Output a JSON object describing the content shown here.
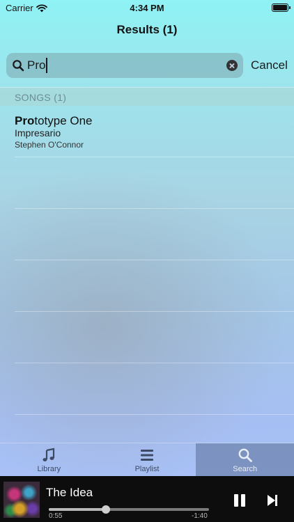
{
  "status_bar": {
    "carrier": "Carrier",
    "time": "4:34 PM"
  },
  "nav": {
    "title": "Results (1)"
  },
  "search": {
    "query": "Pro",
    "cancel_label": "Cancel"
  },
  "section": {
    "label": "SONGS (1)"
  },
  "results": [
    {
      "title_match": "Pro",
      "title_rest": "totype One",
      "album": "Impresario",
      "artist": "Stephen O'Connor"
    }
  ],
  "tabs": [
    {
      "label": "Library",
      "icon": "music-note-icon",
      "selected": false
    },
    {
      "label": "Playlist",
      "icon": "list-icon",
      "selected": false
    },
    {
      "label": "Search",
      "icon": "search-icon",
      "selected": true
    }
  ],
  "player": {
    "title": "The Idea",
    "elapsed": "0:55",
    "remaining": "-1:40",
    "progress": 0.355
  },
  "colors": {
    "selected_tab": "#5a6e96",
    "player_bg": "#0d0d0d"
  }
}
